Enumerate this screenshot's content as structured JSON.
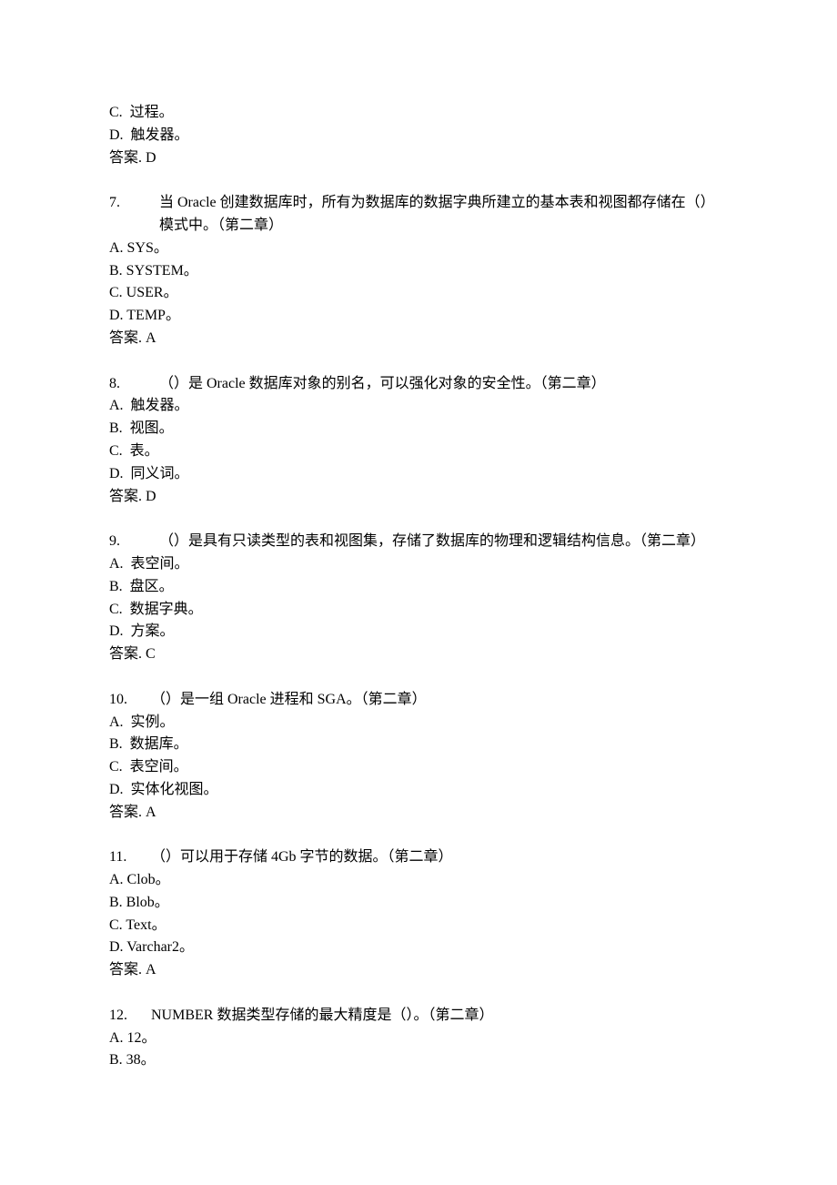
{
  "pre": {
    "c": "C.  过程。",
    "d": "D.  触发器。",
    "ans": "答案. D"
  },
  "q7": {
    "num": "7.",
    "text": "当 Oracle 创建数据库时，所有为数据库的数据字典所建立的基本表和视图都存储在（）模式中。（第二章）",
    "a": "A. SYS。",
    "b": "B. SYSTEM。",
    "c": "C. USER。",
    "d": "D. TEMP。",
    "ans": "答案. A"
  },
  "q8": {
    "num": "8.",
    "text": "（）是 Oracle 数据库对象的别名，可以强化对象的安全性。（第二章）",
    "a": "A.  触发器。",
    "b": "B.  视图。",
    "c": "C.  表。",
    "d": "D.  同义词。",
    "ans": "答案. D"
  },
  "q9": {
    "num": "9.",
    "text": "（）是具有只读类型的表和视图集，存储了数据库的物理和逻辑结构信息。（第二章）",
    "a": "A.  表空间。",
    "b": "B.  盘区。",
    "c": "C.  数据字典。",
    "d": "D.  方案。",
    "ans": "答案. C"
  },
  "q10": {
    "num": "10.",
    "text": "（）是一组 Oracle 进程和 SGA。（第二章）",
    "a": "A.  实例。",
    "b": "B.  数据库。",
    "c": "C.  表空间。",
    "d": "D.  实体化视图。",
    "ans": "答案. A"
  },
  "q11": {
    "num": "11.",
    "text": "（）可以用于存储 4Gb 字节的数据。（第二章）",
    "a": "A. Clob。",
    "b": "B. Blob。",
    "c": "C. Text。",
    "d": "D. Varchar2。",
    "ans": "答案. A"
  },
  "q12": {
    "num": "12.",
    "text": "NUMBER 数据类型存储的最大精度是（）。（第二章）",
    "a": "A. 12。",
    "b": "B. 38。"
  }
}
